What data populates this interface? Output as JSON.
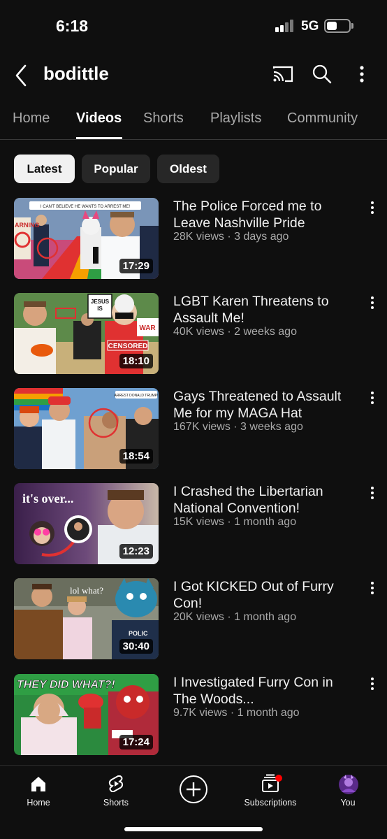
{
  "status_bar": {
    "time": "6:18",
    "network": "5G"
  },
  "header": {
    "channel_name": "bodittle"
  },
  "tabs": [
    {
      "label": "Home",
      "active": false
    },
    {
      "label": "Videos",
      "active": true
    },
    {
      "label": "Shorts",
      "active": false
    },
    {
      "label": "Playlists",
      "active": false
    },
    {
      "label": "Community",
      "active": false
    }
  ],
  "filters": {
    "chips": [
      "Latest",
      "Popular",
      "Oldest"
    ],
    "selected": "Latest"
  },
  "thumbnail_texts": {
    "v1_caption": "I CAN'T BELIEVE HE WANTS TO ARREST ME!",
    "v1_sign": "ARNING",
    "v2_sign_a": "JESUS",
    "v2_sign_b": "IS",
    "v2_censored": "CENSORED",
    "v2_warn": "WAR",
    "v3_caption": "ARREST DONALD TRUMP!",
    "v4_caption": "it's over...",
    "v5_caption": "lol what?",
    "v5_police": "POLIC",
    "v6_caption": "THEY DID WHAT?!"
  },
  "videos": [
    {
      "title": "The Police Forced me to Leave Nashville Pride",
      "meta": "28K views · 3 days ago",
      "duration": "17:29"
    },
    {
      "title": "LGBT Karen Threatens to Assault Me!",
      "meta": "40K views · 2 weeks ago",
      "duration": "18:10"
    },
    {
      "title": "Gays Threatened to Assault Me for my MAGA Hat",
      "meta": "167K views · 3 weeks ago",
      "duration": "18:54"
    },
    {
      "title": "I Crashed the Libertarian National Convention!",
      "meta": "15K views · 1 month ago",
      "duration": "12:23"
    },
    {
      "title": "I Got KICKED Out of Furry Con!",
      "meta": "20K views · 1 month ago",
      "duration": "30:40"
    },
    {
      "title": "I Investigated Furry Con in The Woods...",
      "meta": "9.7K views · 1 month ago",
      "duration": "17:24"
    }
  ],
  "bottom_nav": [
    {
      "label": "Home",
      "icon": "home-icon"
    },
    {
      "label": "Shorts",
      "icon": "shorts-icon"
    },
    {
      "label": "",
      "icon": "create-icon"
    },
    {
      "label": "Subscriptions",
      "icon": "subscriptions-icon"
    },
    {
      "label": "You",
      "icon": "avatar"
    }
  ],
  "colors": {
    "background": "#0f0f0f",
    "accent_red": "#ff0000",
    "chip_selected": "#f1f1f1",
    "chip": "#272727"
  }
}
